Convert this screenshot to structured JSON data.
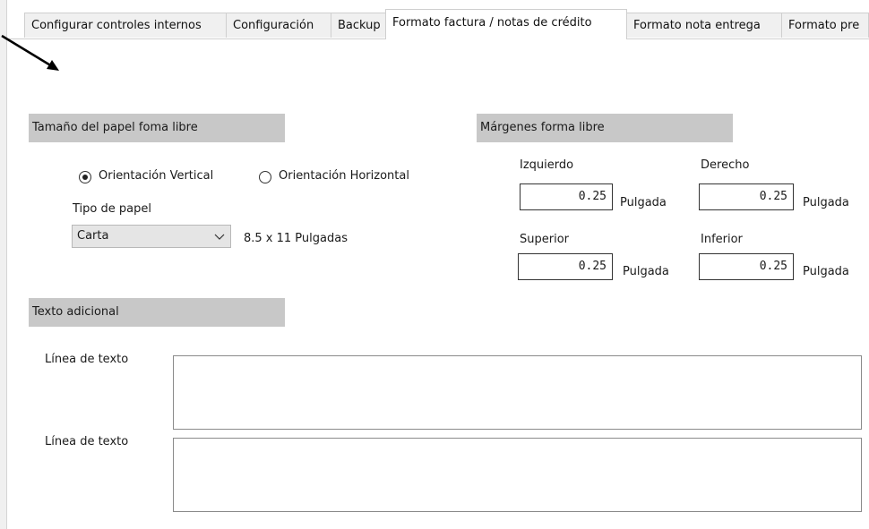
{
  "tabs": [
    {
      "label": "Configurar controles internos"
    },
    {
      "label": "Configuración"
    },
    {
      "label": "Backup"
    },
    {
      "label": "Formato factura / notas de crédito"
    },
    {
      "label": "Formato nota entrega"
    },
    {
      "label": "Formato pre"
    }
  ],
  "paper": {
    "header": "Tamaño del papel foma libre",
    "orientation_vertical": "Orientación Vertical",
    "orientation_horizontal": "Orientación Horizontal",
    "selected_orientation": "vertical",
    "paper_type_label": "Tipo de papel",
    "paper_type_value": "Carta",
    "paper_size_text": "8.5 x 11 Pulgadas"
  },
  "margins": {
    "header": "Márgenes forma libre",
    "left": {
      "label": "Izquierdo",
      "value": "0.25",
      "unit": "Pulgada"
    },
    "right": {
      "label": "Derecho",
      "value": "0.25",
      "unit": "Pulgada"
    },
    "top": {
      "label": "Superior",
      "value": "0.25",
      "unit": "Pulgada"
    },
    "bottom": {
      "label": "Inferior",
      "value": "0.25",
      "unit": "Pulgada"
    }
  },
  "extra_text": {
    "header": "Texto adicional",
    "line1_label": "Línea de texto",
    "line2_label": "Línea de texto"
  },
  "icons": {
    "annotation": "arrow-annotation-icon",
    "dropdown": "chevron-down-icon"
  }
}
